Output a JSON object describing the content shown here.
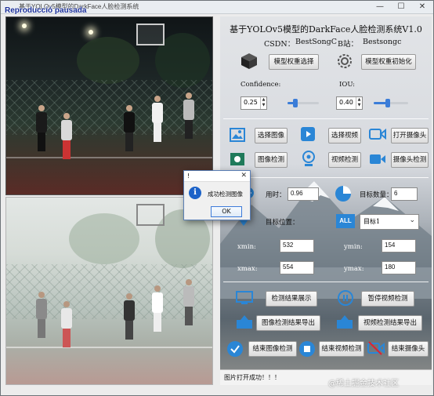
{
  "window": {
    "title": "基于YOLOv5模型的DarkFace人脸检测系统",
    "paused_label": "Reproducció pausada",
    "minimize": "—",
    "maximize": "☐",
    "close": "✕"
  },
  "panel": {
    "title": "基于YOLOv5模型的DarkFace人脸检测系统V1.0",
    "csdn_label": "CSDN：",
    "csdn_value": "BestSongC",
    "bili_label": "B站：",
    "bili_value": "Bestsongc",
    "select_weights_button": "模型权重选择",
    "init_weights_button": "模型权重初始化",
    "confidence_label": "Confidence:",
    "confidence_value": "0.25",
    "confidence_level": 0.25,
    "iou_label": "IOU:",
    "iou_value": "0.40",
    "iou_level": 0.4,
    "select_image_button": "选择图像",
    "select_video_button": "选择视频",
    "open_camera_button": "打开摄像头",
    "image_detect_button": "图像检测",
    "video_detect_button": "视频检测",
    "camera_detect_button": "摄像头检测",
    "time_label": "用时：",
    "time_value": "0.96",
    "count_label": "目标数量：",
    "count_value": "6",
    "position_label": "目标位置：",
    "target_select": "目标1",
    "xmin_label": "xmin:",
    "xmin_value": "532",
    "ymin_label": "ymin:",
    "ymin_value": "154",
    "xmax_label": "xmax:",
    "xmax_value": "554",
    "ymax_label": "ymax:",
    "ymax_value": "180",
    "show_result_button": "检测结果展示",
    "pause_video_button": "暂停视频检测",
    "export_image_button": "图像检测结果导出",
    "export_video_button": "视频检测结果导出",
    "end_image_button": "结束图像检测",
    "end_video_button": "结束视频检测",
    "end_camera_button": "结束摄像头",
    "all_icon_text": "ALL",
    "status_text": "图片打开成功！！！",
    "watermark": "@稀土掘金技术社区"
  },
  "dialog": {
    "title": "!",
    "message": "成功检测图像",
    "ok_button": "OK",
    "close": "✕"
  },
  "colors": {
    "accent": "#3b7dd8",
    "icon_blue": "#2a86d6",
    "paused_text": "#1a2f9a"
  }
}
